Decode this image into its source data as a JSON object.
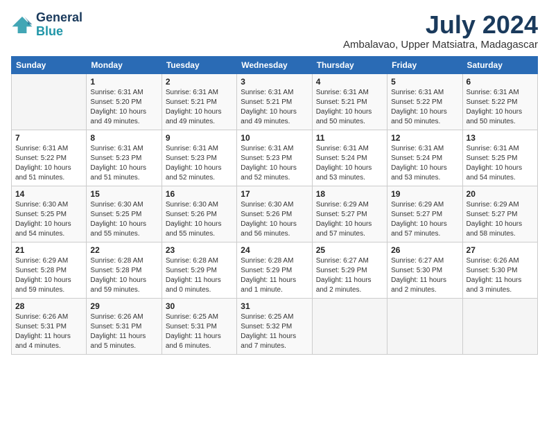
{
  "logo": {
    "line1": "General",
    "line2": "Blue"
  },
  "title": "July 2024",
  "location": "Ambalavao, Upper Matsiatra, Madagascar",
  "days_header": [
    "Sunday",
    "Monday",
    "Tuesday",
    "Wednesday",
    "Thursday",
    "Friday",
    "Saturday"
  ],
  "weeks": [
    [
      {
        "day": "",
        "text": ""
      },
      {
        "day": "1",
        "text": "Sunrise: 6:31 AM\nSunset: 5:20 PM\nDaylight: 10 hours\nand 49 minutes."
      },
      {
        "day": "2",
        "text": "Sunrise: 6:31 AM\nSunset: 5:21 PM\nDaylight: 10 hours\nand 49 minutes."
      },
      {
        "day": "3",
        "text": "Sunrise: 6:31 AM\nSunset: 5:21 PM\nDaylight: 10 hours\nand 49 minutes."
      },
      {
        "day": "4",
        "text": "Sunrise: 6:31 AM\nSunset: 5:21 PM\nDaylight: 10 hours\nand 50 minutes."
      },
      {
        "day": "5",
        "text": "Sunrise: 6:31 AM\nSunset: 5:22 PM\nDaylight: 10 hours\nand 50 minutes."
      },
      {
        "day": "6",
        "text": "Sunrise: 6:31 AM\nSunset: 5:22 PM\nDaylight: 10 hours\nand 50 minutes."
      }
    ],
    [
      {
        "day": "7",
        "text": "Sunrise: 6:31 AM\nSunset: 5:22 PM\nDaylight: 10 hours\nand 51 minutes."
      },
      {
        "day": "8",
        "text": "Sunrise: 6:31 AM\nSunset: 5:23 PM\nDaylight: 10 hours\nand 51 minutes."
      },
      {
        "day": "9",
        "text": "Sunrise: 6:31 AM\nSunset: 5:23 PM\nDaylight: 10 hours\nand 52 minutes."
      },
      {
        "day": "10",
        "text": "Sunrise: 6:31 AM\nSunset: 5:23 PM\nDaylight: 10 hours\nand 52 minutes."
      },
      {
        "day": "11",
        "text": "Sunrise: 6:31 AM\nSunset: 5:24 PM\nDaylight: 10 hours\nand 53 minutes."
      },
      {
        "day": "12",
        "text": "Sunrise: 6:31 AM\nSunset: 5:24 PM\nDaylight: 10 hours\nand 53 minutes."
      },
      {
        "day": "13",
        "text": "Sunrise: 6:31 AM\nSunset: 5:25 PM\nDaylight: 10 hours\nand 54 minutes."
      }
    ],
    [
      {
        "day": "14",
        "text": "Sunrise: 6:30 AM\nSunset: 5:25 PM\nDaylight: 10 hours\nand 54 minutes."
      },
      {
        "day": "15",
        "text": "Sunrise: 6:30 AM\nSunset: 5:25 PM\nDaylight: 10 hours\nand 55 minutes."
      },
      {
        "day": "16",
        "text": "Sunrise: 6:30 AM\nSunset: 5:26 PM\nDaylight: 10 hours\nand 55 minutes."
      },
      {
        "day": "17",
        "text": "Sunrise: 6:30 AM\nSunset: 5:26 PM\nDaylight: 10 hours\nand 56 minutes."
      },
      {
        "day": "18",
        "text": "Sunrise: 6:29 AM\nSunset: 5:27 PM\nDaylight: 10 hours\nand 57 minutes."
      },
      {
        "day": "19",
        "text": "Sunrise: 6:29 AM\nSunset: 5:27 PM\nDaylight: 10 hours\nand 57 minutes."
      },
      {
        "day": "20",
        "text": "Sunrise: 6:29 AM\nSunset: 5:27 PM\nDaylight: 10 hours\nand 58 minutes."
      }
    ],
    [
      {
        "day": "21",
        "text": "Sunrise: 6:29 AM\nSunset: 5:28 PM\nDaylight: 10 hours\nand 59 minutes."
      },
      {
        "day": "22",
        "text": "Sunrise: 6:28 AM\nSunset: 5:28 PM\nDaylight: 10 hours\nand 59 minutes."
      },
      {
        "day": "23",
        "text": "Sunrise: 6:28 AM\nSunset: 5:29 PM\nDaylight: 11 hours\nand 0 minutes."
      },
      {
        "day": "24",
        "text": "Sunrise: 6:28 AM\nSunset: 5:29 PM\nDaylight: 11 hours\nand 1 minute."
      },
      {
        "day": "25",
        "text": "Sunrise: 6:27 AM\nSunset: 5:29 PM\nDaylight: 11 hours\nand 2 minutes."
      },
      {
        "day": "26",
        "text": "Sunrise: 6:27 AM\nSunset: 5:30 PM\nDaylight: 11 hours\nand 2 minutes."
      },
      {
        "day": "27",
        "text": "Sunrise: 6:26 AM\nSunset: 5:30 PM\nDaylight: 11 hours\nand 3 minutes."
      }
    ],
    [
      {
        "day": "28",
        "text": "Sunrise: 6:26 AM\nSunset: 5:31 PM\nDaylight: 11 hours\nand 4 minutes."
      },
      {
        "day": "29",
        "text": "Sunrise: 6:26 AM\nSunset: 5:31 PM\nDaylight: 11 hours\nand 5 minutes."
      },
      {
        "day": "30",
        "text": "Sunrise: 6:25 AM\nSunset: 5:31 PM\nDaylight: 11 hours\nand 6 minutes."
      },
      {
        "day": "31",
        "text": "Sunrise: 6:25 AM\nSunset: 5:32 PM\nDaylight: 11 hours\nand 7 minutes."
      },
      {
        "day": "",
        "text": ""
      },
      {
        "day": "",
        "text": ""
      },
      {
        "day": "",
        "text": ""
      }
    ]
  ]
}
